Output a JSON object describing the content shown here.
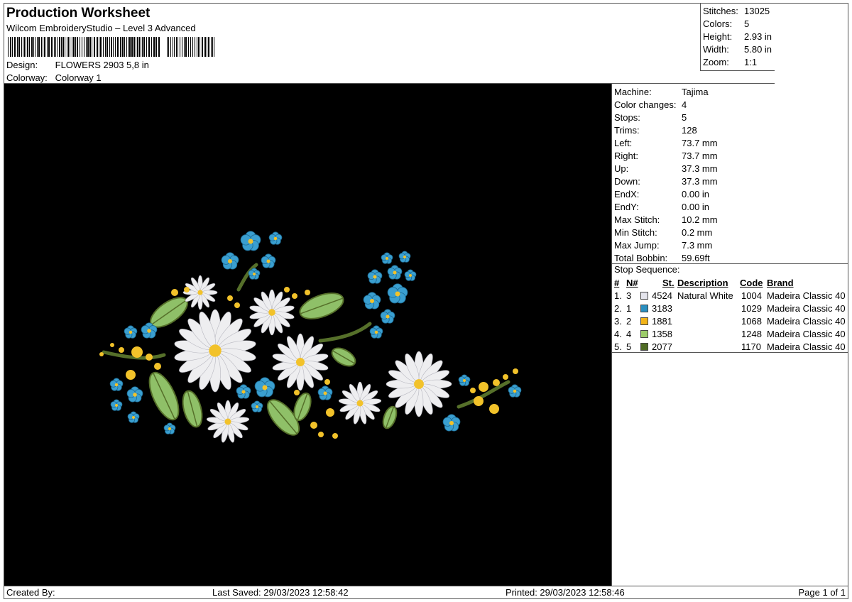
{
  "header": {
    "title": "Production Worksheet",
    "software": "Wilcom EmbroideryStudio – Level 3 Advanced",
    "design_label": "Design:",
    "design_value": "FLOWERS 2903 5,8 in",
    "colorway_label": "Colorway:",
    "colorway_value": "Colorway 1"
  },
  "stats": [
    {
      "label": "Stitches:",
      "value": "13025"
    },
    {
      "label": "Colors:",
      "value": "5"
    },
    {
      "label": "Height:",
      "value": "2.93 in"
    },
    {
      "label": "Width:",
      "value": "5.80 in"
    },
    {
      "label": "Zoom:",
      "value": "1:1"
    }
  ],
  "machine": [
    {
      "label": "Machine:",
      "value": "Tajima"
    },
    {
      "label": "Color changes:",
      "value": "4"
    },
    {
      "label": "Stops:",
      "value": "5"
    },
    {
      "label": "Trims:",
      "value": "128"
    },
    {
      "label": "Left:",
      "value": "73.7 mm"
    },
    {
      "label": "Right:",
      "value": "73.7 mm"
    },
    {
      "label": "Up:",
      "value": "37.3 mm"
    },
    {
      "label": "Down:",
      "value": "37.3 mm"
    },
    {
      "label": "EndX:",
      "value": "0.00 in"
    },
    {
      "label": "EndY:",
      "value": "0.00 in"
    },
    {
      "label": "Max Stitch:",
      "value": "10.2 mm"
    },
    {
      "label": "Min Stitch:",
      "value": "0.2 mm"
    },
    {
      "label": "Max Jump:",
      "value": "7.3 mm"
    },
    {
      "label": "Total Bobbin:",
      "value": "59.69ft"
    }
  ],
  "stop_sequence": {
    "title": "Stop Sequence:",
    "headers": {
      "idx": "#",
      "n": "N#",
      "st": "St.",
      "desc": "Description",
      "code": "Code",
      "brand": "Brand"
    },
    "rows": [
      {
        "idx": "1.",
        "n": "3",
        "color": "#e4e4ec",
        "st": "4524",
        "desc": "Natural White",
        "code": "1004",
        "brand": "Madeira Classic 40"
      },
      {
        "idx": "2.",
        "n": "1",
        "color": "#2a8fc0",
        "st": "3183",
        "desc": "",
        "code": "1029",
        "brand": "Madeira Classic 40"
      },
      {
        "idx": "3.",
        "n": "2",
        "color": "#f2b418",
        "st": "1881",
        "desc": "",
        "code": "1068",
        "brand": "Madeira Classic 40"
      },
      {
        "idx": "4.",
        "n": "4",
        "color": "#9ccc6a",
        "st": "1358",
        "desc": "",
        "code": "1248",
        "brand": "Madeira Classic 40"
      },
      {
        "idx": "5.",
        "n": "5",
        "color": "#4f6b24",
        "st": "2077",
        "desc": "",
        "code": "1170",
        "brand": "Madeira Classic 40"
      }
    ]
  },
  "footer": {
    "created_by": "Created By:",
    "last_saved": "Last Saved: 29/03/2023 12:58:42",
    "printed": "Printed: 29/03/2023 12:58:46",
    "page": "Page 1 of 1"
  },
  "colors": {
    "thread_white": "#eeeef0",
    "thread_blue": "#3a9fd0",
    "thread_yellow": "#f2c22a",
    "thread_light_green": "#8fc068",
    "thread_dark_green": "#56702a",
    "background": "#000000"
  }
}
